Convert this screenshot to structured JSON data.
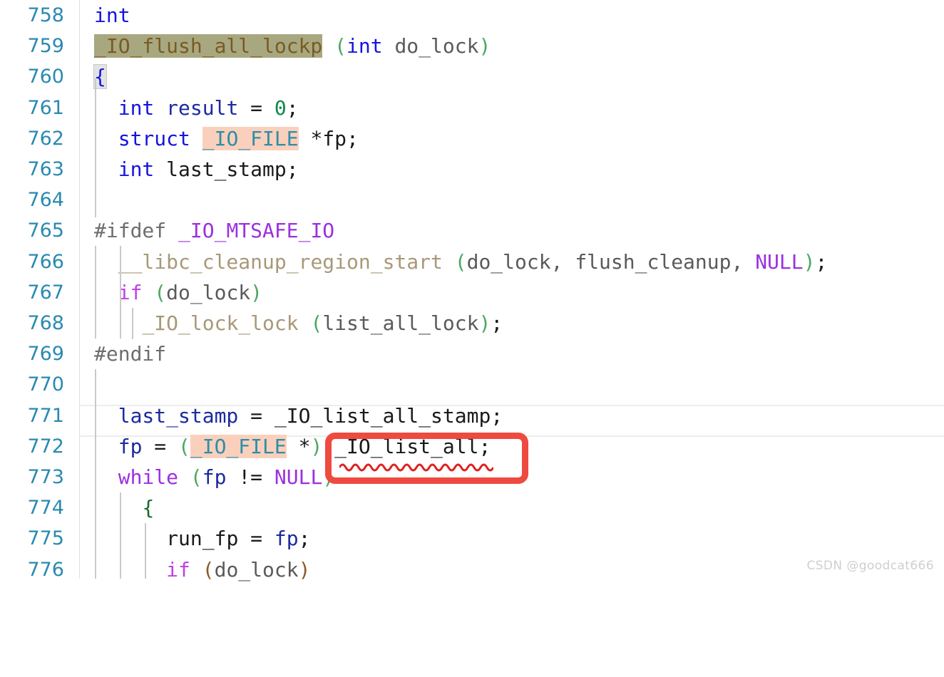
{
  "editor": {
    "language": "c",
    "first_line": 758,
    "last_line": 776,
    "colors": {
      "line_number": "#2a8ab0",
      "occurrence_highlight_bg": "#a8a880",
      "type_highlight_bg": "#fad0bc",
      "bracket_match_bg": "#e3e3e3",
      "annotation_red": "#ef4a3f",
      "error_squiggle": "#e02020",
      "indent_guide": "#c9c9c9",
      "row_separator": "#ededed",
      "watermark": "#cfcfcf"
    }
  },
  "lines": [
    {
      "no": "758",
      "text": "int"
    },
    {
      "no": "759",
      "text": "_IO_flush_all_lockp (int do_lock)"
    },
    {
      "no": "760",
      "text": "{"
    },
    {
      "no": "761",
      "text": "  int result = 0;"
    },
    {
      "no": "762",
      "text": "  struct _IO_FILE *fp;"
    },
    {
      "no": "763",
      "text": "  int last_stamp;"
    },
    {
      "no": "764",
      "text": ""
    },
    {
      "no": "765",
      "text": "#ifdef _IO_MTSAFE_IO"
    },
    {
      "no": "766",
      "text": "  __libc_cleanup_region_start (do_lock, flush_cleanup, NULL);"
    },
    {
      "no": "767",
      "text": "  if (do_lock)"
    },
    {
      "no": "768",
      "text": "    _IO_lock_lock (list_all_lock);"
    },
    {
      "no": "769",
      "text": "#endif"
    },
    {
      "no": "770",
      "text": ""
    },
    {
      "no": "771",
      "text": "  last_stamp = _IO_list_all_stamp;"
    },
    {
      "no": "772",
      "text": "  fp = (_IO_FILE *) _IO_list_all;"
    },
    {
      "no": "773",
      "text": "  while (fp != NULL)"
    },
    {
      "no": "774",
      "text": "    {"
    },
    {
      "no": "775",
      "text": "      run_fp = fp;"
    },
    {
      "no": "776",
      "text": "      if (do_lock)"
    }
  ],
  "tokens": {
    "l758": {
      "int": "int"
    },
    "l759": {
      "fn": "_IO_flush_all_lockp",
      "open": "(",
      "type": "int",
      "param": "do_lock",
      "close": ")"
    },
    "l760": {
      "brace": "{"
    },
    "l761": {
      "int": "int",
      "name": "result",
      "eq": "=",
      "num": "0",
      "semi": ";"
    },
    "l762": {
      "struct": "struct",
      "type": "_IO_FILE",
      "star": "*",
      "name": "fp",
      "semi": ";"
    },
    "l763": {
      "int": "int",
      "name": "last_stamp",
      "semi": ";"
    },
    "l765": {
      "directive": "#ifdef",
      "macro": "_IO_MTSAFE_IO"
    },
    "l766": {
      "fn": "__libc_cleanup_region_start",
      "open": "(",
      "a1": "do_lock",
      "comma1": ",",
      "a2": "flush_cleanup",
      "comma2": ",",
      "a3": "NULL",
      "close": ")",
      "semi": ";"
    },
    "l767": {
      "if": "if",
      "open": "(",
      "cond": "do_lock",
      "close": ")"
    },
    "l768": {
      "fn": "_IO_lock_lock",
      "open": "(",
      "arg": "list_all_lock",
      "close": ")",
      "semi": ";"
    },
    "l769": {
      "directive": "#endif"
    },
    "l771": {
      "lhs": "last_stamp",
      "eq": "=",
      "rhs": "_IO_list_all_stamp",
      "semi": ";"
    },
    "l772": {
      "lhs": "fp",
      "eq": "=",
      "open": "(",
      "type": "_IO_FILE",
      "star": "*",
      "close": ")",
      "rhs": "_IO_list_all",
      "semi": ";"
    },
    "l773": {
      "while": "while",
      "open": "(",
      "lhs": "fp",
      "op": "!=",
      "rhs": "NULL",
      "close": ")"
    },
    "l774": {
      "brace": "{"
    },
    "l775": {
      "lhs": "run_fp",
      "eq": "=",
      "rhs": "fp",
      "semi": ";"
    },
    "l776": {
      "if": "if",
      "open": "(",
      "cond": "do_lock",
      "close": ")"
    }
  },
  "annotation": {
    "kind": "red-rectangle-highlight",
    "target_text": "_IO_list_all;",
    "on_line": "772"
  },
  "diagnostics": {
    "squiggle_under": "_IO_list_all",
    "on_line": "772",
    "style": "red-wavy-underline"
  },
  "watermark": {
    "text": "CSDN @goodcat666"
  }
}
